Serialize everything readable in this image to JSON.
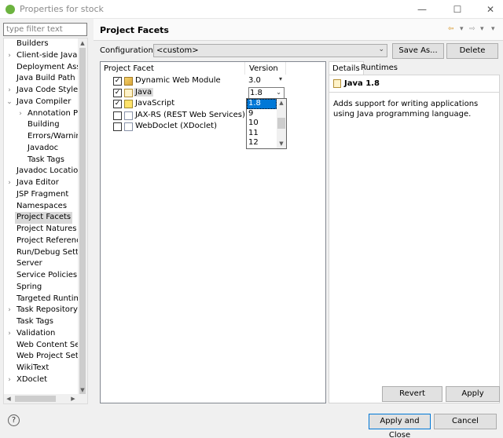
{
  "window": {
    "title": "Properties for stock",
    "minimize_glyph": "—",
    "maximize_glyph": "☐",
    "close_glyph": "✕"
  },
  "filter": {
    "placeholder": "type filter text",
    "value": ""
  },
  "nav": {
    "items": [
      {
        "label": "Builders",
        "expandable": false,
        "level": 0
      },
      {
        "label": "Client-side JavaScr",
        "expandable": true,
        "level": 0
      },
      {
        "label": "Deployment Assem",
        "expandable": false,
        "level": 0
      },
      {
        "label": "Java Build Path",
        "expandable": false,
        "level": 0
      },
      {
        "label": "Java Code Style",
        "expandable": true,
        "level": 0
      },
      {
        "label": "Java Compiler",
        "expandable": true,
        "expanded": true,
        "level": 0
      },
      {
        "label": "Annotation Pro",
        "expandable": true,
        "level": 1
      },
      {
        "label": "Building",
        "expandable": false,
        "level": 1
      },
      {
        "label": "Errors/Warning",
        "expandable": false,
        "level": 1
      },
      {
        "label": "Javadoc",
        "expandable": false,
        "level": 1
      },
      {
        "label": "Task Tags",
        "expandable": false,
        "level": 1
      },
      {
        "label": "Javadoc Location",
        "expandable": false,
        "level": 0
      },
      {
        "label": "Java Editor",
        "expandable": true,
        "level": 0
      },
      {
        "label": "JSP Fragment",
        "expandable": false,
        "level": 0
      },
      {
        "label": "Namespaces",
        "expandable": false,
        "level": 0
      },
      {
        "label": "Project Facets",
        "expandable": false,
        "level": 0,
        "selected": true
      },
      {
        "label": "Project Natures",
        "expandable": false,
        "level": 0
      },
      {
        "label": "Project References",
        "expandable": false,
        "level": 0
      },
      {
        "label": "Run/Debug Settings",
        "expandable": false,
        "level": 0
      },
      {
        "label": "Server",
        "expandable": false,
        "level": 0
      },
      {
        "label": "Service Policies",
        "expandable": false,
        "level": 0
      },
      {
        "label": "Spring",
        "expandable": false,
        "level": 0
      },
      {
        "label": "Targeted Runtimes",
        "expandable": false,
        "level": 0
      },
      {
        "label": "Task Repository",
        "expandable": true,
        "level": 0
      },
      {
        "label": "Task Tags",
        "expandable": false,
        "level": 0
      },
      {
        "label": "Validation",
        "expandable": true,
        "level": 0
      },
      {
        "label": "Web Content Settings",
        "expandable": false,
        "level": 0
      },
      {
        "label": "Web Project Settings",
        "expandable": false,
        "level": 0
      },
      {
        "label": "WikiText",
        "expandable": false,
        "level": 0
      },
      {
        "label": "XDoclet",
        "expandable": true,
        "level": 0
      }
    ]
  },
  "page": {
    "title": "Project Facets",
    "configuration_label": "Configuration:",
    "configuration_value": "<custom>",
    "save_as_label": "Save As...",
    "delete_label": "Delete",
    "history_back_glyph": "⇦",
    "history_forward_glyph": "⇨",
    "dropdown_glyph": "▾"
  },
  "facets": {
    "col_facet": "Project Facet",
    "col_version": "Version",
    "rows": [
      {
        "name": "Dynamic Web Module",
        "checked": true,
        "version": "3.0",
        "icon": "web-module-icon"
      },
      {
        "name": "Java",
        "checked": true,
        "version": "1.8",
        "icon": "java-icon",
        "highlighted": true,
        "open": true
      },
      {
        "name": "JavaScript",
        "checked": true,
        "version": "",
        "icon": "javascript-icon"
      },
      {
        "name": "JAX-RS (REST Web Services)",
        "checked": false,
        "version": "",
        "icon": "jaxrs-icon"
      },
      {
        "name": "WebDoclet (XDoclet)",
        "checked": false,
        "version": "",
        "icon": "webdoclet-icon"
      }
    ],
    "version_options": [
      "1.8",
      "9",
      "10",
      "11",
      "12"
    ],
    "selected_version": "1.8"
  },
  "details": {
    "tab_details": "Details",
    "tab_runtimes": "Runtimes",
    "title": "Java 1.8",
    "description": "Adds support for writing applications using Java programming language."
  },
  "buttons": {
    "revert": "Revert",
    "apply": "Apply",
    "apply_close": "Apply and Close",
    "cancel": "Cancel",
    "help_glyph": "?"
  },
  "colors": {
    "selection_blue": "#0078d7",
    "app_icon_green": "#6cb33f"
  }
}
